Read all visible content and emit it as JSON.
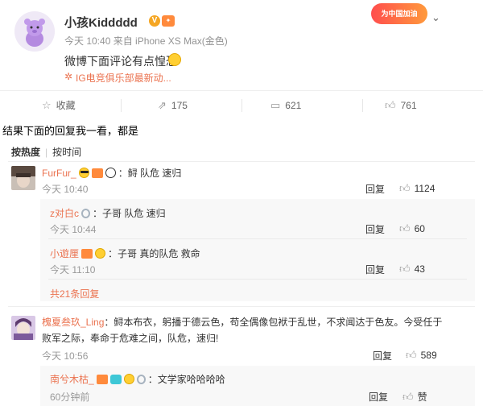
{
  "post": {
    "username": "小孩Kiddddd",
    "meta": "今天 10:40 来自 iPhone XS Max(金色)",
    "text": "微博下面评论有点惶恐",
    "source": "IG电竞俱乐部最新动...",
    "banner_text": "为中国加油",
    "actions": {
      "favorite_label": "收藏",
      "repost_count": "175",
      "comment_count": "621",
      "like_count": "761"
    }
  },
  "caption": "结果下面的回复我一看，都是",
  "sort": {
    "hot": "按热度",
    "time": "按时间"
  },
  "comments": [
    {
      "nick": "FurFur_",
      "text": "：鲟 队危 速归",
      "time": "今天 10:40",
      "reply_label": "回复",
      "likes": "1124",
      "replies": [
        {
          "nick": "z对白c",
          "text": "：子哥 队危 速归",
          "time": "今天 10:44",
          "reply_label": "回复",
          "likes": "60"
        },
        {
          "nick": "小遊厘",
          "text": "：子哥 真的队危 救命",
          "time": "今天 11:10",
          "reply_label": "回复",
          "likes": "43"
        }
      ],
      "more_replies": "共21条回复"
    },
    {
      "nick": "槐夏叁玖_Ling",
      "text_line1": "：鲟本布衣，躬播于德云色，苟全偶像包袱于乱世，不求闻达于色友。今受任于",
      "text_line2": "败军之际，奉命于危难之间，队危，速归!",
      "time": "今天 10:56",
      "reply_label": "回复",
      "likes": "589",
      "replies": [
        {
          "nick": "南兮木枯_",
          "text": "：文学家哈哈哈哈",
          "time": "60分钟前",
          "reply_label": "回复",
          "likes": "赞"
        }
      ]
    }
  ],
  "colors": {
    "accent": "#eb7350",
    "muted": "#999999"
  }
}
